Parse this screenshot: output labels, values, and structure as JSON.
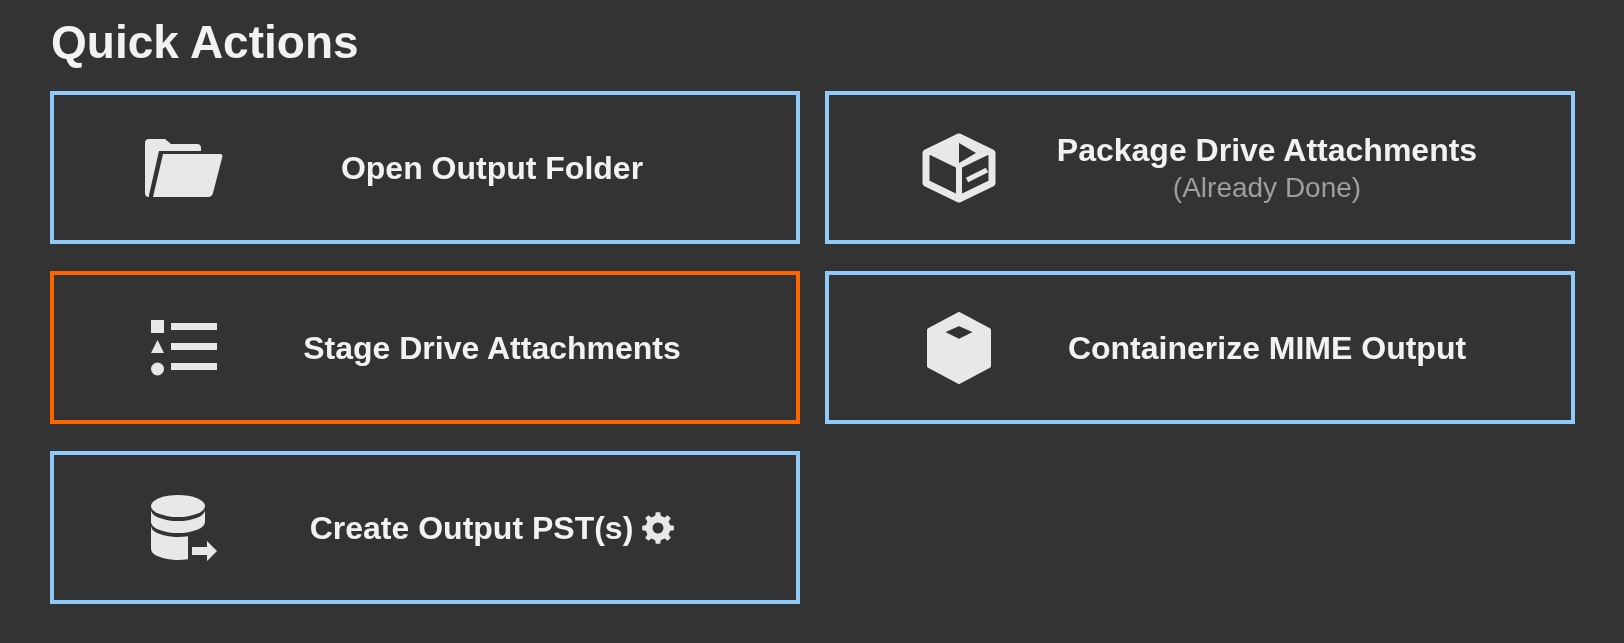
{
  "page": {
    "title": "Quick Actions"
  },
  "actions": [
    {
      "kind": "folder",
      "label": "Open Output Folder",
      "selected": false,
      "settings_icon": false
    },
    {
      "kind": "open-box",
      "label": "Package Drive Attachments",
      "note": "(Already Done)",
      "selected": false,
      "settings_icon": false
    },
    {
      "kind": "list",
      "label": "Stage Drive Attachments",
      "selected": true,
      "settings_icon": false
    },
    {
      "kind": "cube",
      "label": "Containerize MIME Output",
      "selected": false,
      "settings_icon": false
    },
    {
      "kind": "database",
      "label": "Create Output PST(s)",
      "selected": false,
      "settings_icon": true
    }
  ]
}
